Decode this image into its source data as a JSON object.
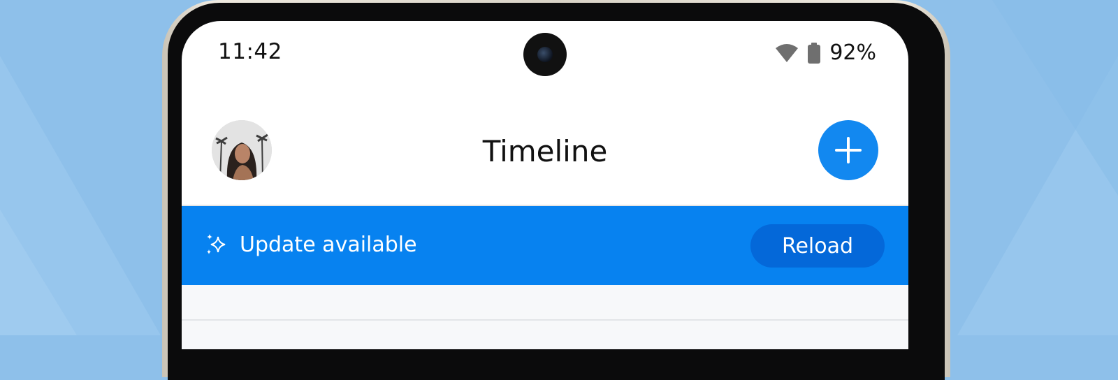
{
  "status_bar": {
    "time": "11:42",
    "battery_percent": "92%",
    "icons": [
      "wifi-icon",
      "battery-icon"
    ]
  },
  "header": {
    "title": "Timeline",
    "avatar": "profile-avatar",
    "add_icon": "plus-icon"
  },
  "banner": {
    "icon": "sparkle-icon",
    "message": "Update available",
    "action_label": "Reload"
  },
  "colors": {
    "accent": "#1288f0",
    "banner": "#0782f0",
    "reload_button": "#0468d9",
    "background": "#8ec0ea"
  }
}
